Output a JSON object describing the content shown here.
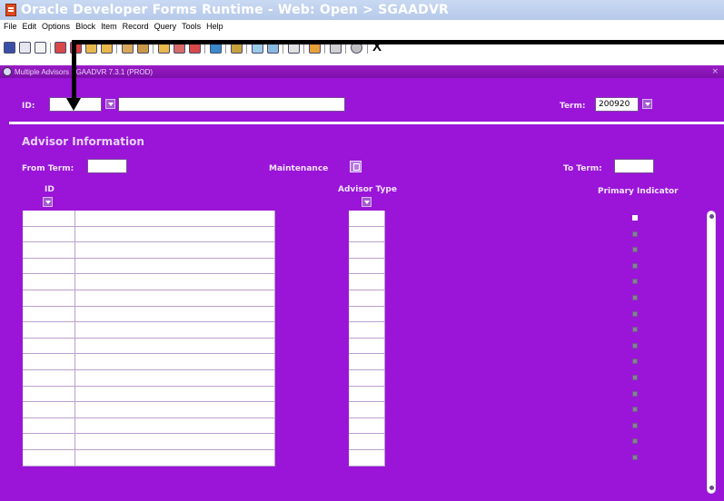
{
  "window": {
    "title": "Oracle Developer Forms Runtime - Web:  Open > SGAADVR"
  },
  "menu": [
    "File",
    "Edit",
    "Options",
    "Block",
    "Item",
    "Record",
    "Query",
    "Tools",
    "Help"
  ],
  "toolbar": {
    "exit_label": "X"
  },
  "form": {
    "title": "Multiple Advisors  SGAADVR  7.3.1  (PROD)",
    "close": "×"
  },
  "key_block": {
    "id_label": "ID:",
    "id_value": "",
    "name_value": "",
    "term_label": "Term:",
    "term_value": "200920"
  },
  "advisor_section": {
    "title": "Advisor Information",
    "from_term_label": "From Term:",
    "from_term_value": "",
    "maintenance_label": "Maintenance",
    "to_term_label": "To Term:",
    "to_term_value": "",
    "columns": {
      "id": "ID",
      "advisor_type": "Advisor Type",
      "primary_indicator": "Primary Indicator"
    },
    "row_count": 16
  }
}
